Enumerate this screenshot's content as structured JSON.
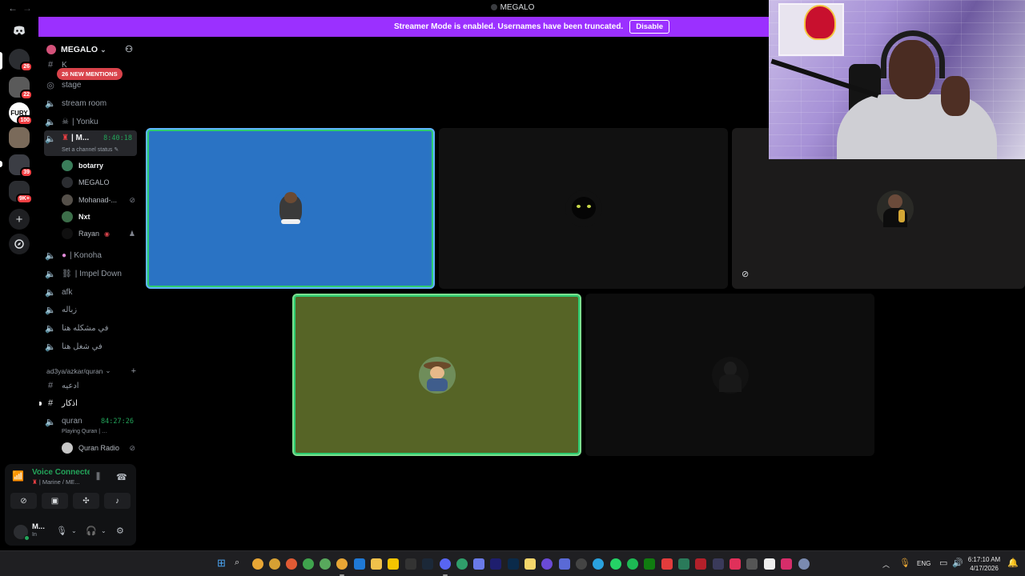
{
  "window": {
    "title": "MEGALO",
    "back_icon": "←",
    "forward_icon": "→"
  },
  "banner": {
    "text": "Streamer Mode is enabled. Usernames have been truncated.",
    "button": "Disable",
    "color": "#9b30ff"
  },
  "rail": {
    "servers": [
      {
        "badge": "26",
        "color": "#2b2d31"
      },
      {
        "badge": "22",
        "color": "#5a5a5a"
      },
      {
        "badge": "100",
        "color": "#ffffff",
        "label": "FURY"
      },
      {
        "badge": "",
        "color": "#7a6a5a"
      },
      {
        "badge": "39",
        "color": "#3b3d44"
      },
      {
        "badge": "9K+",
        "color": "#2b2d31"
      }
    ],
    "add_icon": "+",
    "discover_icon": "compass-icon"
  },
  "guild": {
    "name": "MEGALO",
    "mentions": "26 NEW MENTIONS"
  },
  "channels": {
    "top_partial": "K",
    "stage": "stage",
    "stream_room": "stream room",
    "yonku": "| Yonku",
    "marine": "| M...",
    "marine_timer": "8:40:18",
    "marine_status": "Set a channel status",
    "members": [
      {
        "name": "botarry",
        "color": "#3a7d5a",
        "bold": true
      },
      {
        "name": "MEGALO",
        "color": "#2b2d31",
        "bold": false
      },
      {
        "name": "Mohanad-...",
        "color": "#55504a",
        "bold": false
      },
      {
        "name": "Nxt",
        "color": "#3c6e4a",
        "bold": true
      },
      {
        "name": "Rayan",
        "color": "#101010",
        "bold": false
      }
    ],
    "konoha": "| Konoha",
    "impel": "| Impel Down",
    "afk": "afk",
    "ar1": "زباله",
    "ar2": "في مشكله هنا",
    "ar3": "في شغل هنا",
    "category": "ad3ya/azkar/quran",
    "adeia": "ادعيه",
    "azkar": "اذكار",
    "quran": "quran",
    "quran_timer": "84:27:26",
    "quran_status": "Playing Quran |",
    "quran_radio": "Quran Radio"
  },
  "voice": {
    "title": "Voice Connected",
    "subtitle": "| Marine / ME..."
  },
  "user": {
    "name": "M...",
    "status": "In"
  },
  "tiles": [
    {
      "name": "tile-blue",
      "bg": "#2a73c4",
      "avatar": "#3b3b3b",
      "speaking": true
    },
    {
      "name": "tile-cat",
      "bg": "#111111",
      "avatar": "#0a0a0a",
      "speaking": false
    },
    {
      "name": "tile-man",
      "bg": "#1c1b1b",
      "avatar": "#6a6a60",
      "speaking": false,
      "muted": true
    },
    {
      "name": "tile-olive",
      "bg": "#566426",
      "avatar": "#8a6a3a",
      "speaking": true
    },
    {
      "name": "tile-dark",
      "bg": "#0d0d0d",
      "avatar": "#141414",
      "speaking": false
    }
  ],
  "taskbar": {
    "time": "6:17:10 AM",
    "date": "4/17/2026",
    "lang": "ENG"
  }
}
